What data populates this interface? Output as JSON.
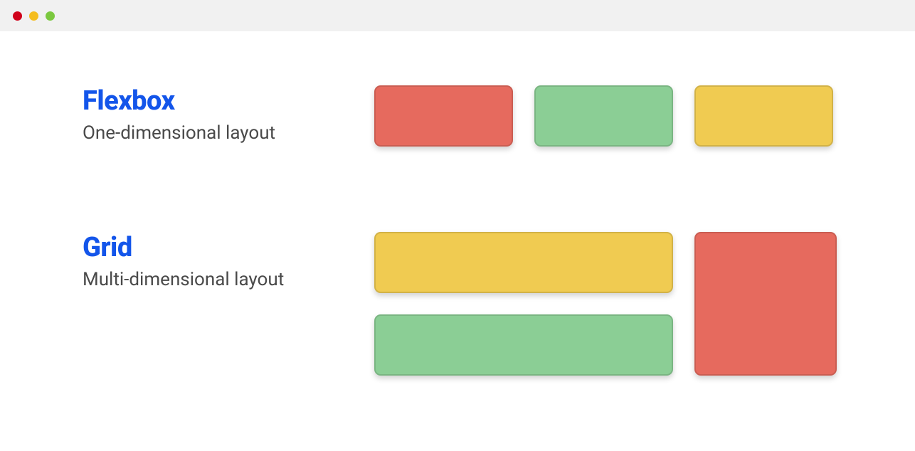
{
  "titlebar": {
    "traffic_lights": [
      "close",
      "minimize",
      "zoom"
    ]
  },
  "sections": {
    "flexbox": {
      "title": "Flexbox",
      "subtitle": "One-dimensional layout",
      "boxes": [
        {
          "color": "red"
        },
        {
          "color": "green"
        },
        {
          "color": "yellow"
        }
      ]
    },
    "grid": {
      "title": "Grid",
      "subtitle": "Multi-dimensional layout",
      "boxes": [
        {
          "color": "yellow",
          "span": "col-1-row-1"
        },
        {
          "color": "red",
          "span": "col-2-row-1-2"
        },
        {
          "color": "green",
          "span": "col-1-row-2"
        }
      ]
    }
  },
  "colors": {
    "title_blue": "#1355ea",
    "box_red": "#e66a5e",
    "box_green": "#8bce95",
    "box_yellow": "#f0cb51",
    "subtitle_gray": "#4a4a4a",
    "titlebar_bg": "#f1f1f1"
  }
}
